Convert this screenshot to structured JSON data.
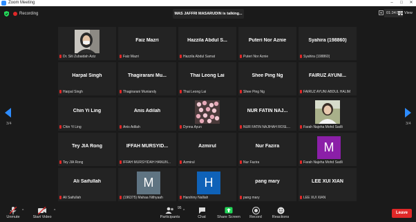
{
  "window": {
    "title": "Zoom Meeting"
  },
  "topbar": {
    "recording_label": "Recording",
    "talking": "MAS JAFFRI MASARUDIN is talking...",
    "timer": "01:34:53",
    "view_label": "View"
  },
  "gallery": {
    "page_left": "3/4",
    "page_right": "3/4",
    "tiles": [
      {
        "big": "",
        "label": "Dr. Siti Zubaidah Aziz",
        "kind": "photo-woman"
      },
      {
        "big": "Faiz Mazri",
        "label": "Faiz Mazri",
        "kind": "name"
      },
      {
        "big": "Hazzila  Abdul  S...",
        "label": "Hazzila Abdul Samat",
        "kind": "name"
      },
      {
        "big": "Puteri Nor Aznie",
        "label": "Puteri Nor Aznie",
        "kind": "name"
      },
      {
        "big": "Syahira (198860)",
        "label": "Syahira (198860)",
        "kind": "name"
      },
      {
        "big": "Harpal Singh",
        "label": "Harpal Singh",
        "kind": "name"
      },
      {
        "big": "Thagirarani  Mu...",
        "label": "Thagirarani Muniandy",
        "kind": "name"
      },
      {
        "big": "Thai Leong Lai",
        "label": "Thai Leong Lai",
        "kind": "name"
      },
      {
        "big": "Shee Ping Ng",
        "label": "Shee Ping Ng",
        "kind": "name"
      },
      {
        "big": "FAIRUZ AYUNI...",
        "label": "FAIRUZ AYUNI ABDUL HALIM",
        "kind": "name"
      },
      {
        "big": "Chin Yi Ling",
        "label": "Chin Yi Ling",
        "kind": "name"
      },
      {
        "big": "Anis Adilah",
        "label": "Anis Adilah",
        "kind": "name"
      },
      {
        "big": "",
        "label": "Dynna Ayun",
        "kind": "photo-flowers"
      },
      {
        "big": "NUR FATIN NAJ...",
        "label": "NUR FATIN NAJIHAH ROSL...",
        "kind": "name"
      },
      {
        "big": "",
        "label": "Farah Najeha Mohd Sadli",
        "kind": "photo-person"
      },
      {
        "big": "Tey JIA Rong",
        "label": "Tey JIA Rong",
        "kind": "name"
      },
      {
        "big": "IFFAH  MURSYID...",
        "label": "IFFAH MURSYIDAH HANUN...",
        "kind": "name"
      },
      {
        "big": "Azmirul",
        "label": "Azmirul",
        "kind": "name"
      },
      {
        "big": "Nur Fazira",
        "label": "Nur Fazira",
        "kind": "name"
      },
      {
        "big": "M",
        "label": "Farah Najeha Mohd Sadli",
        "kind": "avatar",
        "color": "#8b1fa8"
      },
      {
        "big": "Ali Saifullah",
        "label": "Ali Saifullah",
        "kind": "name"
      },
      {
        "big": "M",
        "label": "(196375) Mahaa Nithyaah",
        "kind": "avatar",
        "color": "#5f7482"
      },
      {
        "big": "H",
        "label": "Harshiny Nalliah",
        "kind": "avatar",
        "color": "#0f62b8"
      },
      {
        "big": "pang mary",
        "label": "pang mary",
        "kind": "name"
      },
      {
        "big": "LEE XUI XIAN",
        "label": "LEE XUI XIAN",
        "kind": "name"
      }
    ]
  },
  "toolbar": {
    "unmute": "Unmute",
    "start_video": "Start Video",
    "participants": "Participants",
    "participants_count": "95",
    "chat": "Chat",
    "share_screen": "Share Screen",
    "record": "Record",
    "reactions": "Reactions",
    "leave": "Leave"
  },
  "colors": {
    "accent": "#2d8cff",
    "share": "#23d959",
    "danger": "#e02828"
  }
}
